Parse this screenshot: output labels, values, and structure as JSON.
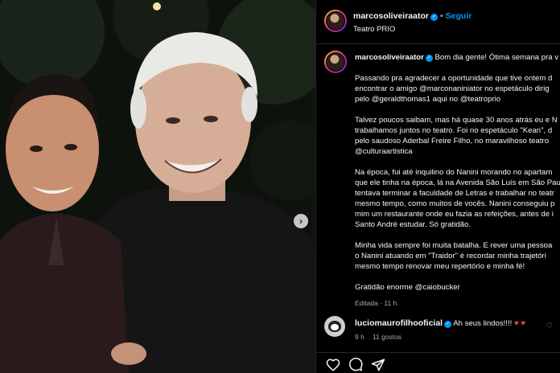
{
  "post": {
    "photo_alt": "photo",
    "carousel_next": "›"
  },
  "header": {
    "username": "marcosoliveiraator",
    "follow": "Seguir",
    "location": "Teatro PRIO"
  },
  "caption": {
    "username": "marcosoliveiraator",
    "paragraphs": [
      "Bom dia gente! Ótima semana pra v",
      "Passando pra agradecer a oportunidade que tive ontem d",
      "encontrar o amigo @marconaniniator no espetáculo dirig",
      "pelo @geraldthomas1 aqui no @teatroprio",
      "Talvez poucos saibam, mas há quase 30 anos atrás eu e N",
      "trabalhamos juntos no teatro. Foi no espetáculo \"Kean\", d",
      "pelo saudoso Aderbal Freire Filho, no maravilhoso teatro",
      "@culturaartistica",
      "Na época, fui até inquilino do Nanini morando no apartam",
      "que ele tinha na época, lá na Avenida São Luís em São Pau",
      "tentava terminar a faculdade de Letras e trabalhar no teatr",
      "mesmo tempo, como muitos de vocês. Nanini conseguiu p",
      "mim um restaurante onde eu fazia as refeições, antes de i",
      "Santo André estudar. Só gratidão.",
      "Minha vida sempre foi muita batalha. E rever uma pessoa",
      "o Nanini atuando em \"Traidor\" é recordar minha trajetóri",
      "mesmo tempo renovar meu repertório e minha fé!",
      "Gratidão enorme @caiobucker"
    ],
    "edited": "Editada",
    "edited_time": "11 h"
  },
  "comment": {
    "username": "luciomaurofilhooficial",
    "text": "Ah seus lindos!!!!",
    "hearts": "♥ ♥",
    "time": "9 h",
    "likes": "11 gostos"
  },
  "colors": {
    "accent": "#0095f6",
    "background": "#000000",
    "heart": "#ed4956"
  },
  "icons": [
    "heart-icon",
    "comment-icon",
    "share-icon"
  ]
}
